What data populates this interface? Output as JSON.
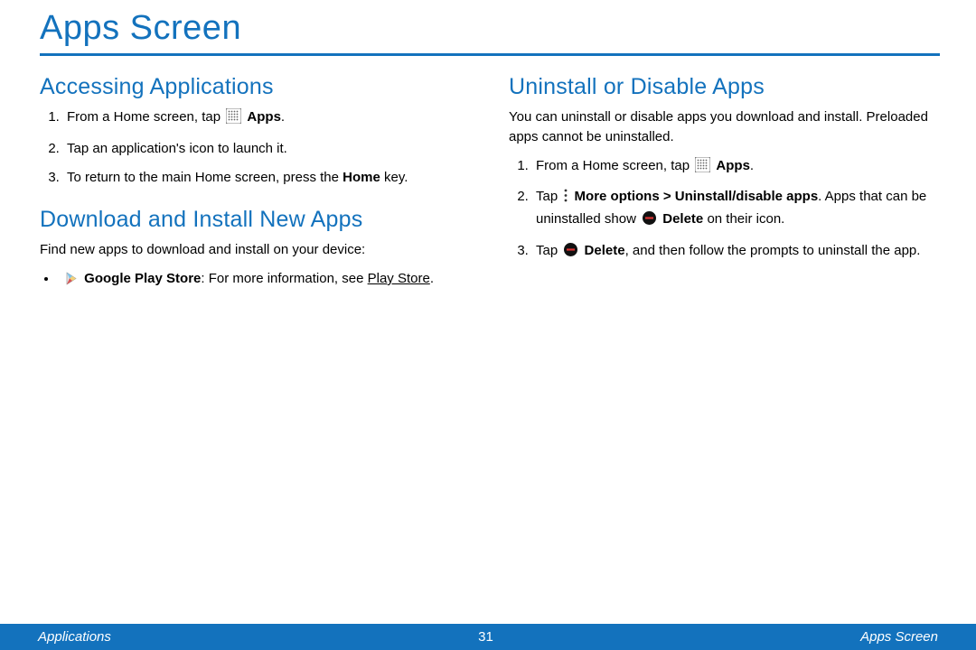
{
  "pageTitle": "Apps Screen",
  "leftColumn": {
    "section1": {
      "heading": "Accessing Applications",
      "step1_pre": "From a Home screen, tap ",
      "step1_bold": "Apps",
      "step1_post": ".",
      "step2": "Tap an application's icon to launch it.",
      "step3_pre": "To return to the main Home screen, press the ",
      "step3_bold": "Home",
      "step3_post": " key."
    },
    "section2": {
      "heading": "Download and Install New Apps",
      "intro": "Find new apps to download and install on your device:",
      "bullet_bold": "Google Play Store",
      "bullet_mid": ": For more information, see ",
      "bullet_link": "Play Store",
      "bullet_post": "."
    }
  },
  "rightColumn": {
    "section": {
      "heading": "Uninstall or Disable Apps",
      "intro": "You can uninstall or disable apps you download and install. Preloaded apps cannot be uninstalled.",
      "step1_pre": "From a Home screen, tap ",
      "step1_bold": "Apps",
      "step1_post": ".",
      "step2_pre": "Tap ",
      "step2_bold1": "More options > Uninstall/disable apps",
      "step2_mid": ". Apps that can be uninstalled show ",
      "step2_bold2": "Delete",
      "step2_post": " on their icon.",
      "step3_pre": "Tap ",
      "step3_bold": "Delete",
      "step3_post": ", and then follow the prompts to uninstall the app."
    }
  },
  "footer": {
    "left": "Applications",
    "center": "31",
    "right": "Apps Screen"
  }
}
